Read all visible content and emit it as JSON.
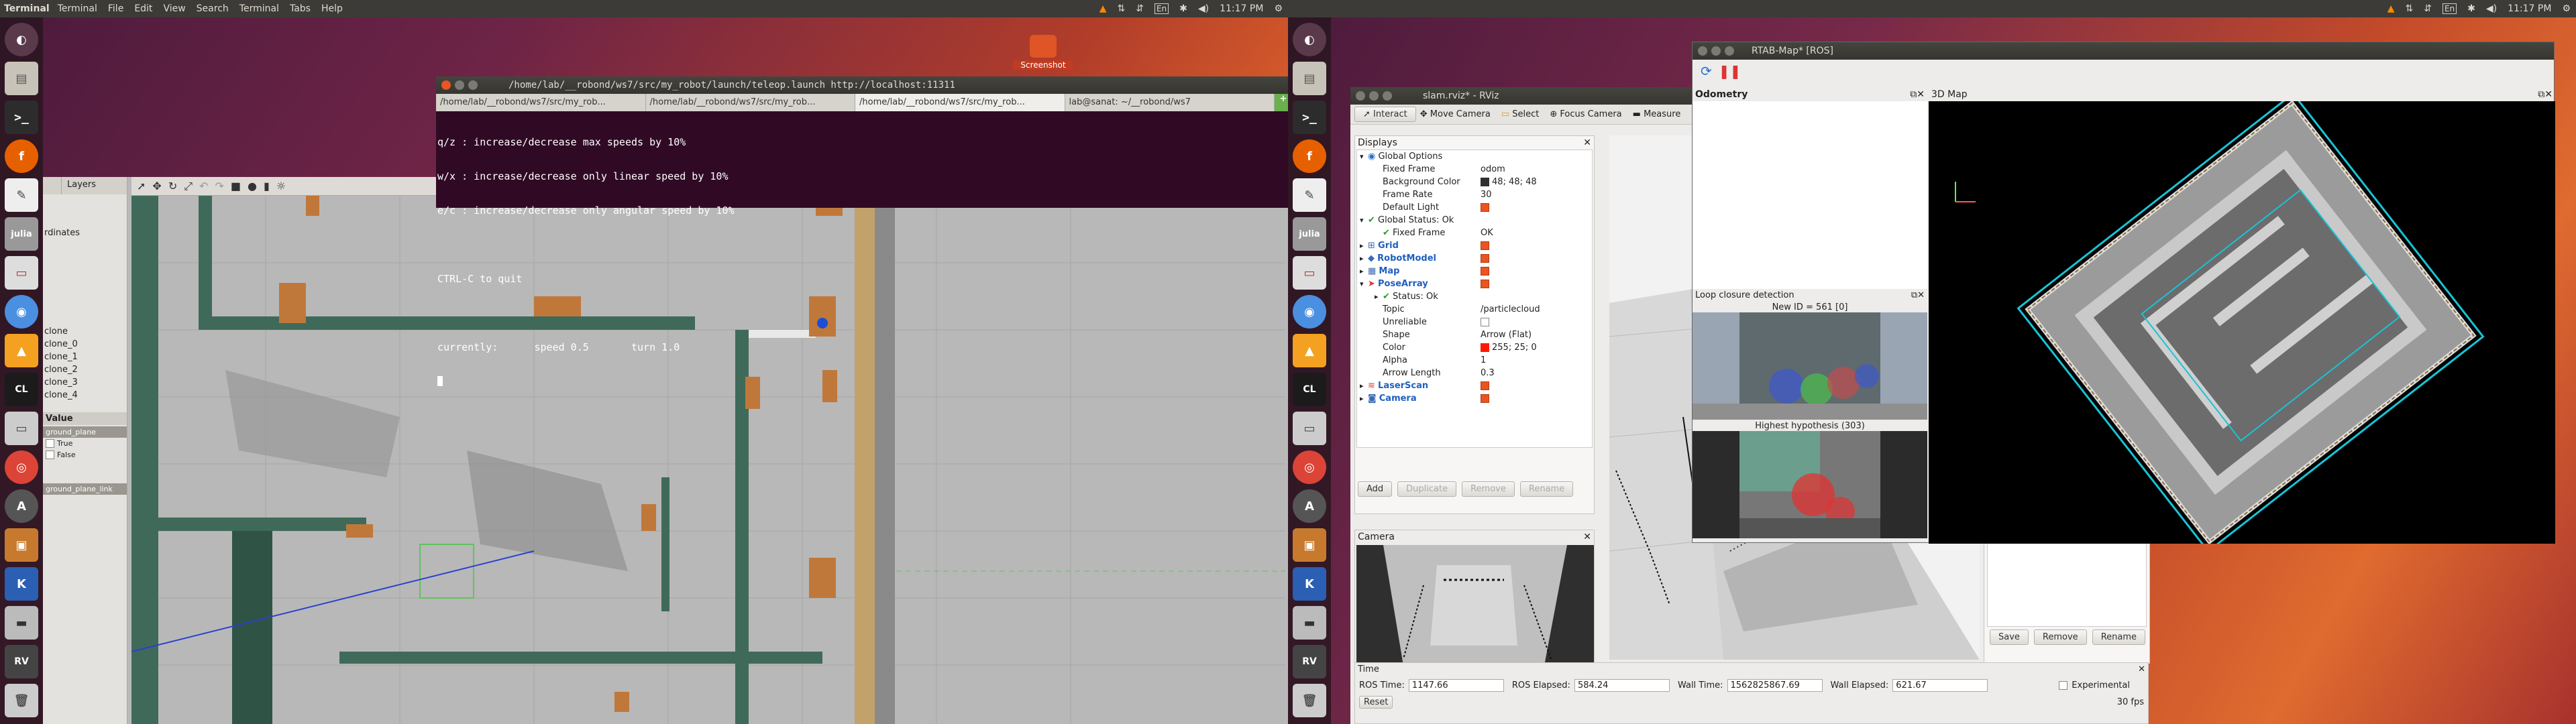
{
  "left_topbar": {
    "app": "Terminal",
    "menu": [
      "Terminal",
      "File",
      "Edit",
      "View",
      "Search",
      "Terminal",
      "Tabs",
      "Help"
    ],
    "time": "11:17 PM",
    "kbd": "En"
  },
  "right_topbar": {
    "time": "11:17 PM",
    "kbd": "En"
  },
  "terminal": {
    "title": "/home/lab/__robond/ws7/src/my_robot/launch/teleop.launch http://localhost:11311",
    "tabs": [
      "/home/lab/__robond/ws7/src/my_rob...",
      "/home/lab/__robond/ws7/src/my_rob...",
      "/home/lab/__robond/ws7/src/my_rob...",
      "lab@sanat: ~/__robond/ws7"
    ],
    "lines": [
      "q/z : increase/decrease max speeds by 10%",
      "w/x : increase/decrease only linear speed by 10%",
      "e/c : increase/decrease only angular speed by 10%",
      "",
      "CTRL-C to quit",
      "",
      "currently:      speed 0.5       turn 1.0"
    ]
  },
  "gazebo": {
    "panel_tab": "Layers",
    "coord_label": "rdinates",
    "objects": [
      "clone",
      "clone_0",
      "clone_1",
      "clone_2",
      "clone_3",
      "clone_4"
    ],
    "prop_header": "Value",
    "props": [
      "ground_plane",
      "True",
      "False",
      "ground_plane_link"
    ]
  },
  "screenshot_label": "Screenshot",
  "rviz": {
    "title": "slam.rviz* - RViz",
    "tools": [
      "Interact",
      "Move Camera",
      "Select",
      "Focus Camera",
      "Measure"
    ],
    "displays_title": "Displays",
    "rows": [
      {
        "k": "Global Options",
        "v": "",
        "bold": false,
        "blue": false
      },
      {
        "k": "Fixed Frame",
        "v": "odom"
      },
      {
        "k": "Background Color",
        "v": "48; 48; 48"
      },
      {
        "k": "Frame Rate",
        "v": "30"
      },
      {
        "k": "Default Light",
        "v": ""
      },
      {
        "k": "Global Status: Ok",
        "v": ""
      },
      {
        "k": "Fixed Frame",
        "v": "OK"
      },
      {
        "k": "Grid",
        "v": ""
      },
      {
        "k": "RobotModel",
        "v": ""
      },
      {
        "k": "Map",
        "v": ""
      },
      {
        "k": "PoseArray",
        "v": ""
      },
      {
        "k": "Status: Ok",
        "v": ""
      },
      {
        "k": "Topic",
        "v": "/particlecloud"
      },
      {
        "k": "Unreliable",
        "v": ""
      },
      {
        "k": "Shape",
        "v": "Arrow (Flat)"
      },
      {
        "k": "Color",
        "v": "255; 25; 0"
      },
      {
        "k": "Alpha",
        "v": "1"
      },
      {
        "k": "Arrow Length",
        "v": "0.3"
      },
      {
        "k": "LaserScan",
        "v": ""
      },
      {
        "k": "Camera",
        "v": ""
      }
    ],
    "buttons": [
      "Add",
      "Duplicate",
      "Remove",
      "Rename"
    ],
    "camera_title": "Camera",
    "right_buttons": [
      "Save",
      "Remove",
      "Rename"
    ],
    "time_title": "Time",
    "ros_time_label": "ROS Time:",
    "ros_time": "1147.66",
    "ros_elapsed_label": "ROS Elapsed:",
    "ros_elapsed": "584.24",
    "wall_time_label": "Wall Time:",
    "wall_time": "1562825867.69",
    "wall_elapsed_label": "Wall Elapsed:",
    "wall_elapsed": "621.67",
    "experimental": "Experimental",
    "reset": "Reset",
    "fps": "30 fps"
  },
  "rtabmap": {
    "title": "RTAB-Map* [ROS]",
    "odometry": "Odometry",
    "map3d": "3D Map",
    "loop": "Loop closure detection",
    "new_id": "New ID = 561 [0]",
    "hyp": "Highest hypothesis (303)"
  }
}
